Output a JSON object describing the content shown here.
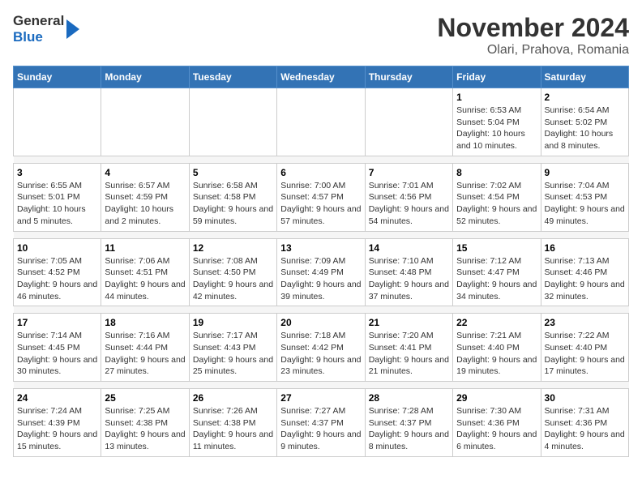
{
  "logo": {
    "line1": "General",
    "line2": "Blue"
  },
  "title": "November 2024",
  "subtitle": "Olari, Prahova, Romania",
  "headers": [
    "Sunday",
    "Monday",
    "Tuesday",
    "Wednesday",
    "Thursday",
    "Friday",
    "Saturday"
  ],
  "weeks": [
    [
      {
        "day": "",
        "info": ""
      },
      {
        "day": "",
        "info": ""
      },
      {
        "day": "",
        "info": ""
      },
      {
        "day": "",
        "info": ""
      },
      {
        "day": "",
        "info": ""
      },
      {
        "day": "1",
        "info": "Sunrise: 6:53 AM\nSunset: 5:04 PM\nDaylight: 10 hours and 10 minutes."
      },
      {
        "day": "2",
        "info": "Sunrise: 6:54 AM\nSunset: 5:02 PM\nDaylight: 10 hours and 8 minutes."
      }
    ],
    [
      {
        "day": "3",
        "info": "Sunrise: 6:55 AM\nSunset: 5:01 PM\nDaylight: 10 hours and 5 minutes."
      },
      {
        "day": "4",
        "info": "Sunrise: 6:57 AM\nSunset: 4:59 PM\nDaylight: 10 hours and 2 minutes."
      },
      {
        "day": "5",
        "info": "Sunrise: 6:58 AM\nSunset: 4:58 PM\nDaylight: 9 hours and 59 minutes."
      },
      {
        "day": "6",
        "info": "Sunrise: 7:00 AM\nSunset: 4:57 PM\nDaylight: 9 hours and 57 minutes."
      },
      {
        "day": "7",
        "info": "Sunrise: 7:01 AM\nSunset: 4:56 PM\nDaylight: 9 hours and 54 minutes."
      },
      {
        "day": "8",
        "info": "Sunrise: 7:02 AM\nSunset: 4:54 PM\nDaylight: 9 hours and 52 minutes."
      },
      {
        "day": "9",
        "info": "Sunrise: 7:04 AM\nSunset: 4:53 PM\nDaylight: 9 hours and 49 minutes."
      }
    ],
    [
      {
        "day": "10",
        "info": "Sunrise: 7:05 AM\nSunset: 4:52 PM\nDaylight: 9 hours and 46 minutes."
      },
      {
        "day": "11",
        "info": "Sunrise: 7:06 AM\nSunset: 4:51 PM\nDaylight: 9 hours and 44 minutes."
      },
      {
        "day": "12",
        "info": "Sunrise: 7:08 AM\nSunset: 4:50 PM\nDaylight: 9 hours and 42 minutes."
      },
      {
        "day": "13",
        "info": "Sunrise: 7:09 AM\nSunset: 4:49 PM\nDaylight: 9 hours and 39 minutes."
      },
      {
        "day": "14",
        "info": "Sunrise: 7:10 AM\nSunset: 4:48 PM\nDaylight: 9 hours and 37 minutes."
      },
      {
        "day": "15",
        "info": "Sunrise: 7:12 AM\nSunset: 4:47 PM\nDaylight: 9 hours and 34 minutes."
      },
      {
        "day": "16",
        "info": "Sunrise: 7:13 AM\nSunset: 4:46 PM\nDaylight: 9 hours and 32 minutes."
      }
    ],
    [
      {
        "day": "17",
        "info": "Sunrise: 7:14 AM\nSunset: 4:45 PM\nDaylight: 9 hours and 30 minutes."
      },
      {
        "day": "18",
        "info": "Sunrise: 7:16 AM\nSunset: 4:44 PM\nDaylight: 9 hours and 27 minutes."
      },
      {
        "day": "19",
        "info": "Sunrise: 7:17 AM\nSunset: 4:43 PM\nDaylight: 9 hours and 25 minutes."
      },
      {
        "day": "20",
        "info": "Sunrise: 7:18 AM\nSunset: 4:42 PM\nDaylight: 9 hours and 23 minutes."
      },
      {
        "day": "21",
        "info": "Sunrise: 7:20 AM\nSunset: 4:41 PM\nDaylight: 9 hours and 21 minutes."
      },
      {
        "day": "22",
        "info": "Sunrise: 7:21 AM\nSunset: 4:40 PM\nDaylight: 9 hours and 19 minutes."
      },
      {
        "day": "23",
        "info": "Sunrise: 7:22 AM\nSunset: 4:40 PM\nDaylight: 9 hours and 17 minutes."
      }
    ],
    [
      {
        "day": "24",
        "info": "Sunrise: 7:24 AM\nSunset: 4:39 PM\nDaylight: 9 hours and 15 minutes."
      },
      {
        "day": "25",
        "info": "Sunrise: 7:25 AM\nSunset: 4:38 PM\nDaylight: 9 hours and 13 minutes."
      },
      {
        "day": "26",
        "info": "Sunrise: 7:26 AM\nSunset: 4:38 PM\nDaylight: 9 hours and 11 minutes."
      },
      {
        "day": "27",
        "info": "Sunrise: 7:27 AM\nSunset: 4:37 PM\nDaylight: 9 hours and 9 minutes."
      },
      {
        "day": "28",
        "info": "Sunrise: 7:28 AM\nSunset: 4:37 PM\nDaylight: 9 hours and 8 minutes."
      },
      {
        "day": "29",
        "info": "Sunrise: 7:30 AM\nSunset: 4:36 PM\nDaylight: 9 hours and 6 minutes."
      },
      {
        "day": "30",
        "info": "Sunrise: 7:31 AM\nSunset: 4:36 PM\nDaylight: 9 hours and 4 minutes."
      }
    ]
  ]
}
